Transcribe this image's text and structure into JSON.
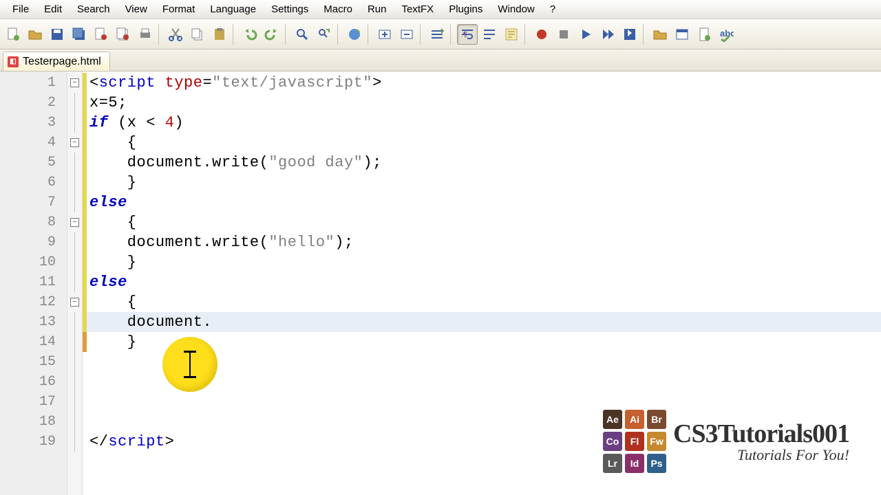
{
  "menu": {
    "items": [
      "File",
      "Edit",
      "Search",
      "View",
      "Format",
      "Language",
      "Settings",
      "Macro",
      "Run",
      "TextFX",
      "Plugins",
      "Window",
      "?"
    ]
  },
  "toolbar_icons": [
    "new-file",
    "open-file",
    "save",
    "save-all",
    "close",
    "close-all",
    "print",
    "sep",
    "cut",
    "copy",
    "paste",
    "sep",
    "undo",
    "redo",
    "sep",
    "find",
    "replace",
    "sep",
    "bookmark",
    "sep",
    "zoom-in",
    "zoom-out",
    "sep",
    "sync",
    "sep",
    "wordwrap",
    "show-chars",
    "indent-guide",
    "sep",
    "record",
    "stop",
    "play",
    "play-multiple",
    "save-macro",
    "sep",
    "folder",
    "browser",
    "doc",
    "spellcheck"
  ],
  "tab": {
    "filename": "Testerpage.html"
  },
  "code": {
    "lines": [
      {
        "n": "1",
        "fold": "box",
        "tokens": [
          [
            "<",
            "punc"
          ],
          [
            "script",
            "tagkw"
          ],
          [
            " ",
            "punc"
          ],
          [
            "type",
            "attr"
          ],
          [
            "=",
            "punc"
          ],
          [
            "\"text/javascript\"",
            "str"
          ],
          [
            ">",
            "punc"
          ]
        ]
      },
      {
        "n": "2",
        "fold": "v",
        "tokens": [
          [
            "x",
            "punc"
          ],
          [
            "=",
            "punc"
          ],
          [
            "5",
            ""
          ],
          [
            ";",
            "punc"
          ]
        ]
      },
      {
        "n": "3",
        "fold": "v",
        "tokens": [
          [
            "if",
            "kw"
          ],
          [
            " (x < ",
            ""
          ],
          [
            "4",
            "num"
          ],
          [
            ")",
            ""
          ]
        ]
      },
      {
        "n": "4",
        "fold": "box",
        "tokens": [
          [
            "    {",
            ""
          ]
        ]
      },
      {
        "n": "5",
        "fold": "v",
        "tokens": [
          [
            "    document.write(",
            ""
          ],
          [
            "\"good day\"",
            "str"
          ],
          [
            ");",
            ""
          ]
        ]
      },
      {
        "n": "6",
        "fold": "v",
        "tokens": [
          [
            "    }",
            ""
          ]
        ]
      },
      {
        "n": "7",
        "fold": "v",
        "tokens": [
          [
            "else",
            "kw"
          ]
        ]
      },
      {
        "n": "8",
        "fold": "box",
        "tokens": [
          [
            "    {",
            ""
          ]
        ]
      },
      {
        "n": "9",
        "fold": "v",
        "tokens": [
          [
            "    document.write(",
            ""
          ],
          [
            "\"hello\"",
            "str"
          ],
          [
            ");",
            ""
          ]
        ]
      },
      {
        "n": "10",
        "fold": "v",
        "tokens": [
          [
            "    }",
            ""
          ]
        ]
      },
      {
        "n": "11",
        "fold": "v",
        "tokens": [
          [
            "else",
            "kw"
          ]
        ]
      },
      {
        "n": "12",
        "fold": "box",
        "tokens": [
          [
            "    {",
            ""
          ]
        ]
      },
      {
        "n": "13",
        "fold": "v",
        "current": true,
        "tokens": [
          [
            "    document.",
            ""
          ]
        ]
      },
      {
        "n": "14",
        "fold": "v",
        "orange": true,
        "tokens": [
          [
            "    }",
            ""
          ]
        ]
      },
      {
        "n": "15",
        "fold": "v",
        "none": true,
        "tokens": [
          [
            "",
            ""
          ]
        ]
      },
      {
        "n": "16",
        "fold": "v",
        "none": true,
        "tokens": [
          [
            "",
            ""
          ]
        ]
      },
      {
        "n": "17",
        "fold": "v",
        "none": true,
        "tokens": [
          [
            "",
            ""
          ]
        ]
      },
      {
        "n": "18",
        "fold": "v",
        "none": true,
        "tokens": [
          [
            "",
            ""
          ]
        ]
      },
      {
        "n": "19",
        "fold": "v",
        "none": true,
        "tokens": [
          [
            "</",
            "punc"
          ],
          [
            "script",
            "tagkw"
          ],
          [
            ">",
            "punc"
          ]
        ]
      }
    ]
  },
  "watermark": {
    "title": "CS3Tutorials001",
    "subtitle": "Tutorials For You!",
    "apps": [
      {
        "t": "Ae",
        "c": "#4a3322"
      },
      {
        "t": "Ai",
        "c": "#c5602f"
      },
      {
        "t": "Br",
        "c": "#7a4a2f"
      },
      {
        "t": "Co",
        "c": "#6a3f82"
      },
      {
        "t": "Fl",
        "c": "#b0301e"
      },
      {
        "t": "Fw",
        "c": "#c58a2f"
      },
      {
        "t": "Lr",
        "c": "#5a5a5a"
      },
      {
        "t": "Id",
        "c": "#8a2f6a"
      },
      {
        "t": "Ps",
        "c": "#2f5f8a"
      }
    ]
  }
}
